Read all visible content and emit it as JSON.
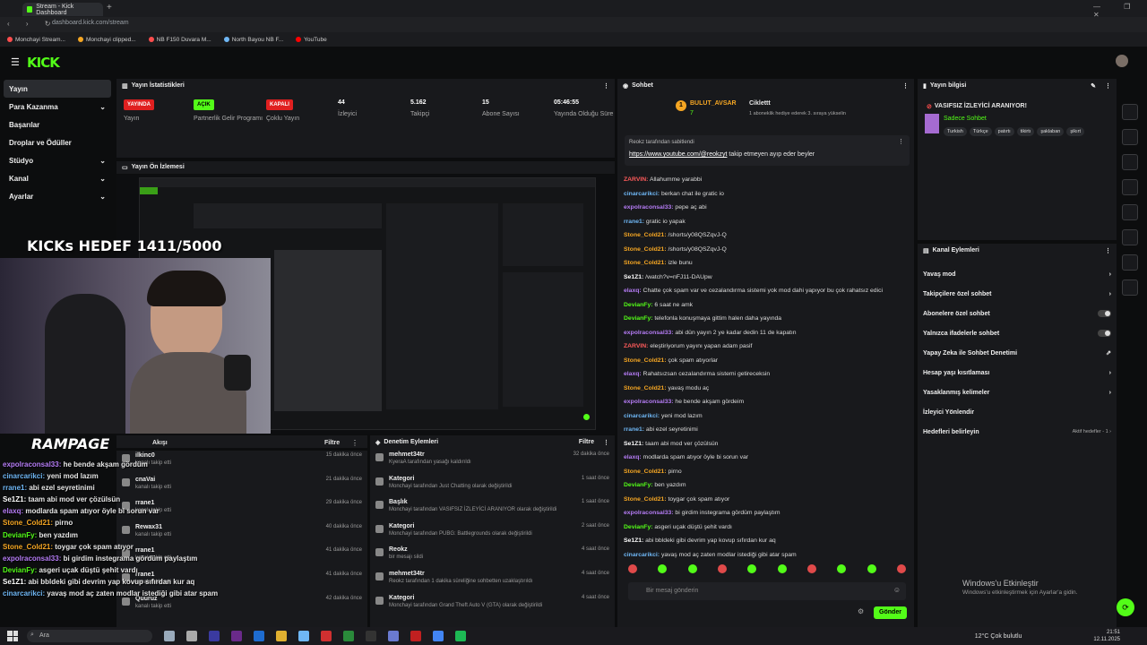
{
  "browser": {
    "tab_title": "Stream - Kick Dashboard",
    "url": "dashboard.kick.com/stream",
    "bookmarks": [
      "Monchayi Stream...",
      "Monchayi clipped...",
      "NB F150 Duvara M...",
      "North Bayou NB F...",
      "YouTube"
    ]
  },
  "logo": "KICK",
  "sidebar": [
    "Yayın",
    "Para Kazanma",
    "Başarılar",
    "Droplar ve Ödüller",
    "Stüdyo",
    "Kanal",
    "Ayarlar"
  ],
  "stats": {
    "title": "Yayın İstatistikleri",
    "items": [
      {
        "value": "YAYINDA",
        "label": "Yayın"
      },
      {
        "value": "AÇIK",
        "label": "Partnerlik Gelir Programı"
      },
      {
        "value": "KAPALI",
        "label": "Çoklu Yayın"
      },
      {
        "value": "44",
        "label": "İzleyici"
      },
      {
        "value": "5.162",
        "label": "Takipçi"
      },
      {
        "value": "15",
        "label": "Abone Sayısı"
      },
      {
        "value": "05:46:55",
        "label": "Yayında Olduğu Süre"
      }
    ]
  },
  "preview_title": "Yayın Ön İzlemesi",
  "overlay": {
    "goal": "KICKs HEDEF 1411/5000",
    "brand": "RAMPAGE",
    "chat": [
      {
        "u": "expolraconsal33:",
        "m": " he bende akşam gördüm",
        "c": "#b57cf5"
      },
      {
        "u": "cinarcarikci:",
        "m": " yeni mod lazım",
        "c": "#6fb7f5"
      },
      {
        "u": "rrane1:",
        "m": " abi ezel seyretinimi",
        "c": "#6fb7f5"
      },
      {
        "u": "Se1Z1:",
        "m": " taam abi mod ver çözülsün",
        "c": "#ffffff"
      },
      {
        "u": "elaxq:",
        "m": " modlarda spam atıyor öyle bi sorun var",
        "c": "#b57cf5"
      },
      {
        "u": "Stone_Cold21:",
        "m": " pirno",
        "c": "#f5a623"
      },
      {
        "u": "DevianFy:",
        "m": " ben yazdım",
        "c": "#53fc18"
      },
      {
        "u": "Stone_Cold21:",
        "m": " toygar çok spam atıyor",
        "c": "#f5a623"
      },
      {
        "u": "expolraconsal33:",
        "m": " bi girdim instegrama gördüm paylaştım",
        "c": "#b57cf5"
      },
      {
        "u": "DevianFy:",
        "m": " asgeri uçak düştü şehit vardı",
        "c": "#53fc18"
      },
      {
        "u": "Se1Z1:",
        "m": " abi bbldeki gibi devrim yap kovup sıfırdan kur aq",
        "c": "#ffffff"
      },
      {
        "u": "cinarcarikci:",
        "m": " yavaş mod aç zaten modlar istediği gibi atar spam",
        "c": "#6fb7f5"
      }
    ]
  },
  "activity": {
    "title": "Akışı",
    "filter": "Filtre",
    "items": [
      {
        "name": "ilkinc0",
        "sub": "kanalı takip etti",
        "time": "15 dakika önce"
      },
      {
        "name": "cnaVai",
        "sub": "kanalı takip etti",
        "time": "21 dakika önce"
      },
      {
        "name": "rrane1",
        "sub": "kanalı takip etti",
        "time": "29 dakika önce"
      },
      {
        "name": "Rewax31",
        "sub": "kanalı takip etti",
        "time": "40 dakika önce"
      },
      {
        "name": "rrane1",
        "sub": "kanalı takip etti",
        "time": "41 dakika önce"
      },
      {
        "name": "rrane1",
        "sub": "kanalı takip etti",
        "time": "41 dakika önce"
      },
      {
        "name": "Quuruz",
        "sub": "kanalı takip etti",
        "time": "42 dakika önce"
      }
    ]
  },
  "moderation": {
    "title": "Denetim Eylemleri",
    "filter": "Filtre",
    "items": [
      {
        "name": "mehmet34tr",
        "sub": "KyeraA tarafından yasağı kaldırıldı",
        "time": "32 dakika önce"
      },
      {
        "name": "Kategori",
        "sub": "Monchayi tarafından Just Chatting olarak değiştirildi",
        "time": "1 saat önce"
      },
      {
        "name": "Başlık",
        "sub": "Monchayi tarafından VASIFSIZ İZLEYİCİ ARANIYOR olarak değiştirildi",
        "time": "1 saat önce"
      },
      {
        "name": "Kategori",
        "sub": "Monchayi tarafından PUBG: Battlegrounds olarak değiştirildi",
        "time": "2 saat önce"
      },
      {
        "name": "Reokz",
        "sub": "bir mesajı sildi",
        "time": "4 saat önce"
      },
      {
        "name": "mehmet34tr",
        "sub": "Reokz tarafından 1 dakika süreliğine sohbetten uzaklaştırıldı",
        "time": "4 saat önce"
      },
      {
        "name": "Kategori",
        "sub": "Monchayi tarafından Grand Theft Auto V (GTA) olarak değiştirildi",
        "time": "4 saat önce"
      }
    ]
  },
  "chat": {
    "title": "Sohbet",
    "top_user": "BULUT_AVSAR",
    "top_count": "7",
    "top2_user": "Ciklettt",
    "top2_sub": "1 aboneklik hediye ederek 3. sıraya yükselin",
    "pinned_by": "Reokz tarafından sabitlendi",
    "pinned_link": "https://www.youtube.com/@reokzyt",
    "pinned_text": " takip etmeyen ayıp eder beyler",
    "messages": [
      {
        "u": "ZARVIN:",
        "m": " Allahumme yarabbi",
        "c": "#ff5b5b"
      },
      {
        "u": "cinarcarikci:",
        "m": " berkan chat ile gratic io",
        "c": "#6fb7f5"
      },
      {
        "u": "expolraconsal33:",
        "m": " pepe aç abi",
        "c": "#b57cf5"
      },
      {
        "u": "rrane1:",
        "m": " gratic io yapak",
        "c": "#6fb7f5"
      },
      {
        "u": "Stone_Cold21:",
        "m": " /shorts/y08QSZqvJ-Q",
        "c": "#f5a623"
      },
      {
        "u": "Stone_Cold21:",
        "m": " /shorts/y08QSZqvJ-Q",
        "c": "#f5a623"
      },
      {
        "u": "Stone_Cold21:",
        "m": " izle bunu",
        "c": "#f5a623"
      },
      {
        "u": "Se1Z1:",
        "m": " /watch?v=nFJ11-DAUpw",
        "c": "#ffffff"
      },
      {
        "u": "elaxq:",
        "m": " Chatte çok spam var ve cezalandırma sistemi yok mod dahi yapıyor bu çok rahatsız edici",
        "c": "#b57cf5"
      },
      {
        "u": "DevianFy:",
        "m": " 6 saat ne amk",
        "c": "#53fc18"
      },
      {
        "u": "DevianFy:",
        "m": " telefonla konuşmaya gittim halen daha yayında",
        "c": "#53fc18"
      },
      {
        "u": "expolraconsal33:",
        "m": " abi dün yayın 2 ye kadar dedin 11 de kapatın",
        "c": "#b57cf5"
      },
      {
        "u": "ZARVIN:",
        "m": " eleştiriyorum yayını yapan adam pasif",
        "c": "#ff5b5b"
      },
      {
        "u": "Stone_Cold21:",
        "m": " çok spam atıyorlar",
        "c": "#f5a623"
      },
      {
        "u": "elaxq:",
        "m": " Rahatsızsan cezalandırma sistemi getireceksin",
        "c": "#b57cf5"
      },
      {
        "u": "Stone_Cold21:",
        "m": " yavaş modu aç",
        "c": "#f5a623"
      },
      {
        "u": "expolraconsal33:",
        "m": " he bende akşam gördeim",
        "c": "#b57cf5"
      },
      {
        "u": "cinarcarikci:",
        "m": " yeni mod lazım",
        "c": "#6fb7f5"
      },
      {
        "u": "rrane1:",
        "m": " abi ezel seyretinimi",
        "c": "#6fb7f5"
      },
      {
        "u": "Se1Z1:",
        "m": " taam abi mod ver çözülsün",
        "c": "#ffffff"
      },
      {
        "u": "elaxq:",
        "m": " modlarda spam atıyor öyle bi sorun var",
        "c": "#b57cf5"
      },
      {
        "u": "Stone_Cold21:",
        "m": " pirno",
        "c": "#f5a623"
      },
      {
        "u": "DevianFy:",
        "m": " ben yazdım",
        "c": "#53fc18"
      },
      {
        "u": "Stone_Cold21:",
        "m": " toygar çok spam atıyor",
        "c": "#f5a623"
      },
      {
        "u": "expolraconsal33:",
        "m": " bi girdim instegrama gördüm paylaştım",
        "c": "#b57cf5"
      },
      {
        "u": "DevianFy:",
        "m": " asgeri uçak düştü şehit vardı",
        "c": "#53fc18"
      },
      {
        "u": "Se1Z1:",
        "m": " abi bbldeki gibi devrim yap kovup sıfırdan kur aq",
        "c": "#ffffff"
      },
      {
        "u": "cinarcarikci:",
        "m": " yavaş mod aç zaten modlar istediği gibi atar spam",
        "c": "#6fb7f5"
      }
    ],
    "placeholder": "Bir mesaj gönderin",
    "send": "Gönder"
  },
  "stream_info": {
    "title": "Yayın bilgisi",
    "stream_title": "VASIFSIZ İZLEYİCİ ARANIYOR!",
    "category": "Sadece Sohbet",
    "tags": [
      "Turkish",
      "Türkçe",
      "patırtı",
      "tikirtı",
      "şaklaban",
      "şikırt"
    ]
  },
  "channel_actions": {
    "title": "Kanal Eylemleri",
    "items": [
      "Yavaş mod",
      "Takipçilere özel sohbet",
      "Abonelere özel sohbet",
      "Yalnızca ifadelerle sohbet",
      "Yapay Zeka ile Sohbet Denetimi",
      "Hesap yaşı kısıtlaması",
      "Yasaklanmış kelimeler",
      "İzleyici Yönlendir",
      "Hedefleri belirleyin"
    ],
    "goal_badge": "Aktif hedefler - 1"
  },
  "windows": {
    "line1": "Windows'u Etkinleştir",
    "line2": "Windows'u etkinleştirmek için Ayarlar'a gidin."
  },
  "taskbar": {
    "search": "Ara",
    "weather": "12°C Çok bulutlu",
    "time": "21:51",
    "date": "12.11.2025"
  }
}
